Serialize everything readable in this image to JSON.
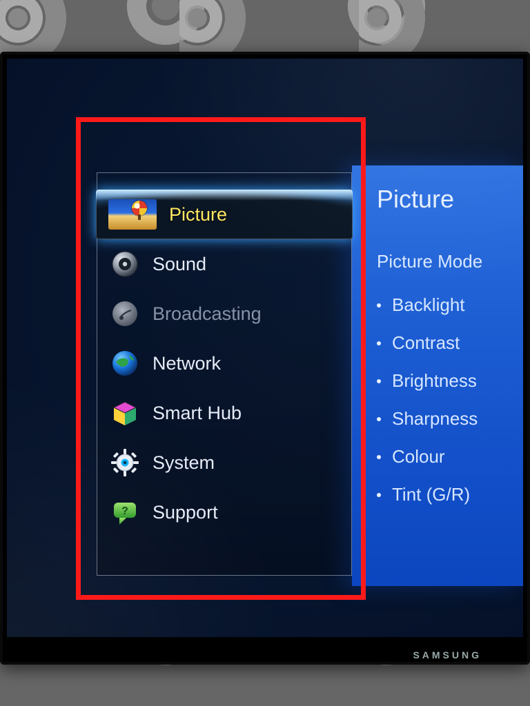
{
  "menu": {
    "items": [
      {
        "label": "Picture",
        "icon": "picture-icon",
        "selected": true,
        "disabled": false
      },
      {
        "label": "Sound",
        "icon": "speaker-icon",
        "selected": false,
        "disabled": false
      },
      {
        "label": "Broadcasting",
        "icon": "satellite-icon",
        "selected": false,
        "disabled": true
      },
      {
        "label": "Network",
        "icon": "globe-icon",
        "selected": false,
        "disabled": false
      },
      {
        "label": "Smart Hub",
        "icon": "cube-icon",
        "selected": false,
        "disabled": false
      },
      {
        "label": "System",
        "icon": "gear-icon",
        "selected": false,
        "disabled": false
      },
      {
        "label": "Support",
        "icon": "help-icon",
        "selected": false,
        "disabled": false
      }
    ]
  },
  "detail": {
    "title": "Picture",
    "subtitle": "Picture Mode",
    "options": [
      "Backlight",
      "Contrast",
      "Brightness",
      "Sharpness",
      "Colour",
      "Tint (G/R)"
    ]
  },
  "device": {
    "brand": "SAMSUNG"
  }
}
